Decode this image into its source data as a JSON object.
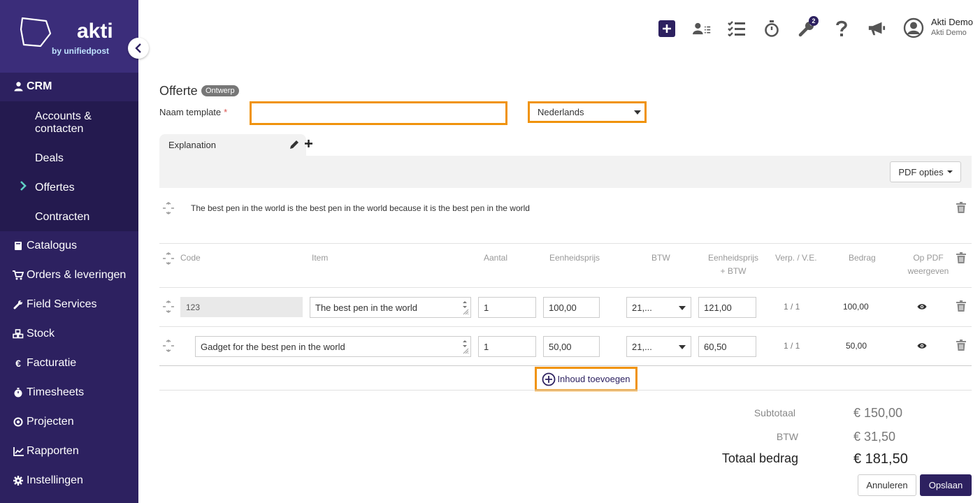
{
  "brand": {
    "name": "akti",
    "sub": "by unifiedpost",
    "primary": "#2d2160",
    "highlight": "#f0930c",
    "accent": "#5fd0c4"
  },
  "sidebar": {
    "crm": "CRM",
    "sub_items": [
      "Accounts &\ncontacten",
      "Deals",
      "Offertes",
      "Contracten"
    ],
    "active_sub": "Offertes",
    "items": [
      {
        "label": "Catalogus",
        "icon": "book-icon"
      },
      {
        "label": "Orders & leveringen",
        "icon": "cart-icon"
      },
      {
        "label": "Field Services",
        "icon": "wrench-icon"
      },
      {
        "label": "Stock",
        "icon": "boxes-icon"
      },
      {
        "label": "Facturatie",
        "icon": "euro-icon"
      },
      {
        "label": "Timesheets",
        "icon": "stopwatch-icon"
      },
      {
        "label": "Projecten",
        "icon": "target-icon"
      },
      {
        "label": "Rapporten",
        "icon": "chart-icon"
      },
      {
        "label": "Instellingen",
        "icon": "gear-icon"
      }
    ]
  },
  "topbar": {
    "badge_count": "2",
    "user_name": "Akti Demo",
    "user_company": "Akti Demo"
  },
  "form": {
    "title": "Offerte",
    "status": "Ontwerp",
    "template_label": "Naam template",
    "required_mark": "*",
    "template_value": "",
    "language": "Nederlands"
  },
  "section": {
    "tab_label": "Explanation",
    "pdf_options": "PDF opties",
    "text": "The best pen in the world is the best pen in the world because it is the best pen in the world"
  },
  "table": {
    "headers": {
      "code": "Code",
      "item": "Item",
      "qty": "Aantal",
      "unit_price": "Eenheidsprijs",
      "vat": "BTW",
      "unit_price_vat_1": "Eenheidsprijs",
      "unit_price_vat_2": "+ BTW",
      "pack": "Verp. / V.E.",
      "amount": "Bedrag",
      "pdf_1": "Op PDF",
      "pdf_2": "weergeven"
    },
    "rows": [
      {
        "code": "123",
        "item": "The best pen in the world",
        "qty": "1",
        "unit_price": "100,00",
        "vat": "21,...",
        "unit_price_vat": "121,00",
        "pack": "1 / 1",
        "amount": "100,00"
      },
      {
        "code": "",
        "item": "Gadget for the best pen in the world",
        "qty": "1",
        "unit_price": "50,00",
        "vat": "21,...",
        "unit_price_vat": "60,50",
        "pack": "1 / 1",
        "amount": "50,00"
      }
    ],
    "add_content": "Inhoud toevoegen"
  },
  "totals": {
    "subtotal_label": "Subtotaal",
    "subtotal": "€ 150,00",
    "vat_label": "BTW",
    "vat": "€ 31,50",
    "total_label": "Totaal bedrag",
    "total": "€ 181,50"
  },
  "actions": {
    "cancel": "Annuleren",
    "save": "Opslaan"
  }
}
